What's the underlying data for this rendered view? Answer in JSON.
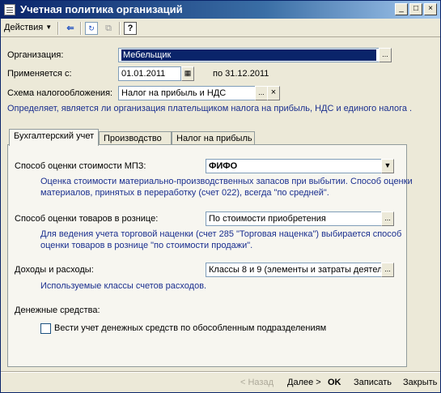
{
  "window": {
    "title": "Учетная политика организаций"
  },
  "toolbar": {
    "actions_label": "Действия",
    "help_label": "?"
  },
  "form": {
    "organization_label": "Организация:",
    "organization_value": "Мебельщик",
    "applies_label": "Применяется с:",
    "applies_value": "01.01.2011",
    "applies_to": "по 31.12.2011",
    "tax_label": "Схема налогообложения:",
    "tax_value": "Налог на прибыль и НДС",
    "tax_description": "Определяет, является ли организация плательщиком налога на прибыль, НДС и единого налога ."
  },
  "tabs": [
    {
      "label": "Бухгалтерский учет"
    },
    {
      "label": "Производство"
    },
    {
      "label": "Налог на прибыль"
    }
  ],
  "accounting": {
    "mpz_label": "Способ оценки стоимости МПЗ:",
    "mpz_value": "ФИФО",
    "mpz_desc_1": "Оценка стоимости материально-производственных запасов при выбытии. Способ оценки",
    "mpz_desc_2": "материалов, принятых в переработку (счет 022), всегда \"по средней\".",
    "retail_label": "Способ оценки товаров в рознице:",
    "retail_value": "По стоимости приобретения",
    "retail_desc_1": "Для ведения учета торговой наценки (счет 285 \"Торговая наценка\") выбирается способ",
    "retail_desc_2": "оценки товаров в рознице \"по стоимости продажи\".",
    "income_label": "Доходы и расходы:",
    "income_value": "Классы 8 и 9 (элементы и затраты деятел",
    "income_desc": "Используемые классы счетов расходов.",
    "cash_label": "Денежные средства:",
    "cash_checkbox_label": "Вести учет денежных средств по обособленным подразделениям",
    "cash_checked": false
  },
  "footer": {
    "back_label": "< Назад",
    "next_label": "Далее >",
    "ok_label": "OK",
    "save_label": "Записать",
    "close_label": "Закрыть"
  }
}
